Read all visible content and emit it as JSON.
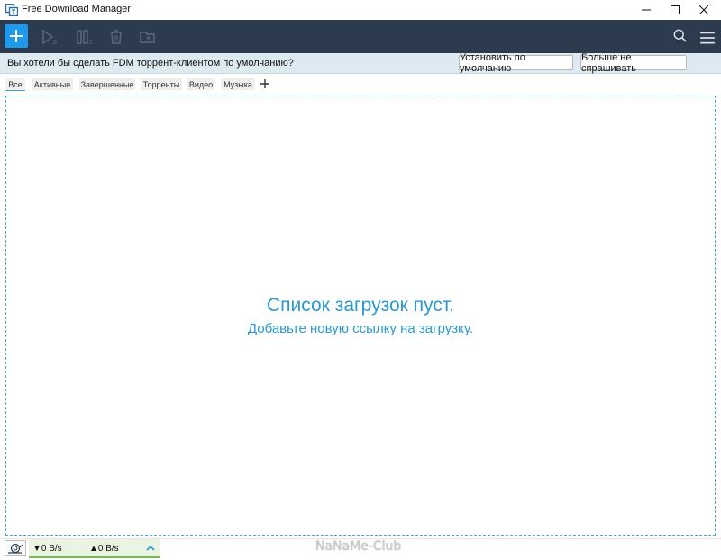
{
  "window": {
    "title": "Free Download Manager"
  },
  "toolbar": {
    "buttons": [
      {
        "icon": "plus-icon",
        "enabled": true
      },
      {
        "icon": "play-icon",
        "enabled": false
      },
      {
        "icon": "pause-icon",
        "enabled": false
      },
      {
        "icon": "trash-icon",
        "enabled": false
      },
      {
        "icon": "folder-icon",
        "enabled": false
      }
    ],
    "right": [
      {
        "icon": "search-icon"
      },
      {
        "icon": "menu-icon"
      }
    ]
  },
  "notify": {
    "text": "Вы хотели бы сделать FDM торрент-клиентом по умолчанию?",
    "set_default_label": "Установить по умолчанию",
    "dont_ask_label": "Больше не спрашивать"
  },
  "tabs": {
    "items": [
      {
        "label": "Все",
        "active": true
      },
      {
        "label": "Активные",
        "active": false
      },
      {
        "label": "Завершенные",
        "active": false
      },
      {
        "label": "Торренты",
        "active": false
      },
      {
        "label": "Видео",
        "active": false
      },
      {
        "label": "Музыка",
        "active": false
      }
    ],
    "add_label": "+"
  },
  "empty": {
    "title": "Список загрузок пуст.",
    "subtitle": "Добавьте новую ссылку на загрузку."
  },
  "status": {
    "download_speed": "▼0 B/s",
    "upload_speed": "▲0 B/s"
  },
  "watermark": "NaNaMe-Club",
  "colors": {
    "toolbar_bg": "#2c3b4d",
    "accent": "#1f9aea",
    "empty_text": "#2a99cf",
    "notify_bg": "#deeaf2"
  }
}
